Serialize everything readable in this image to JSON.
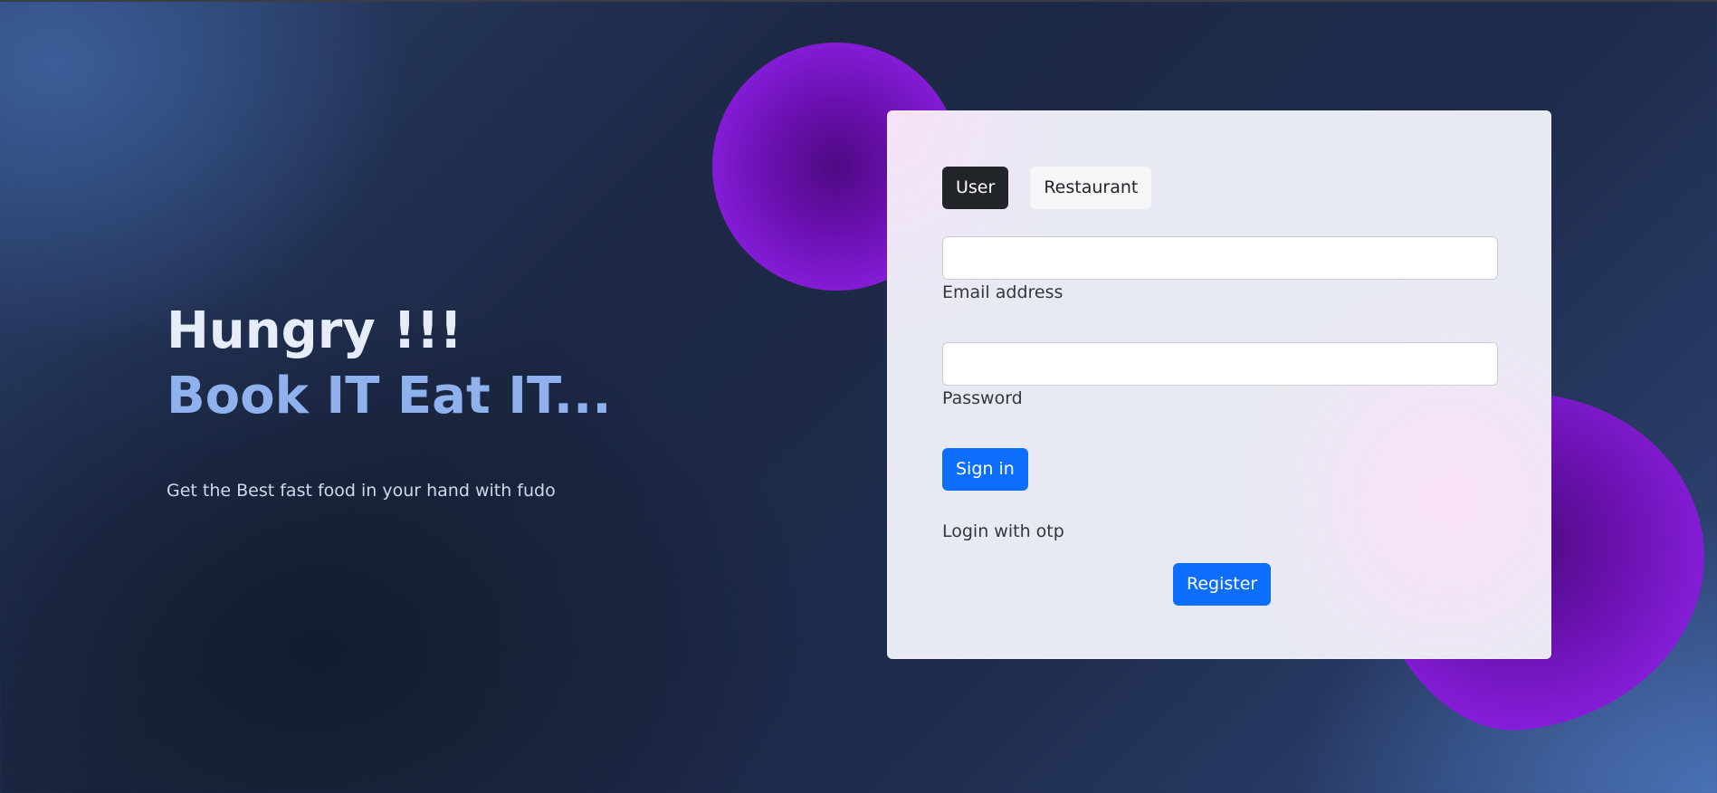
{
  "hero": {
    "title": "Hungry !!!",
    "subtitle": "Book IT Eat IT...",
    "tagline": "Get the Best fast food in your hand with fudo"
  },
  "login": {
    "tabs": [
      {
        "label": "User",
        "active": true
      },
      {
        "label": "Restaurant",
        "active": false
      }
    ],
    "email": {
      "label": "Email address",
      "value": "",
      "placeholder": ""
    },
    "password": {
      "label": "Password",
      "value": "",
      "placeholder": ""
    },
    "sign_in_label": "Sign in",
    "otp_label": "Login with otp",
    "register_label": "Register"
  },
  "colors": {
    "accent": "#0d6efd",
    "active_tab": "#212529",
    "blob": "#8b1fe0",
    "hero_highlight": "#8fb2ef"
  }
}
